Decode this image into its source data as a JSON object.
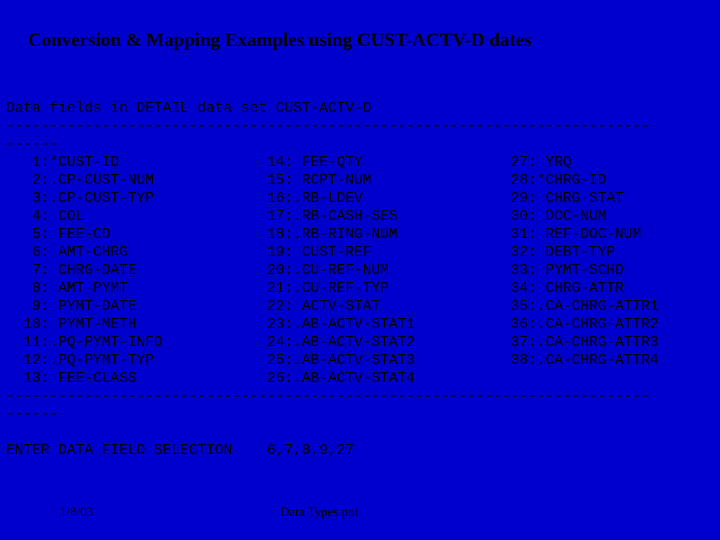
{
  "title": "Conversion & Mapping Examples using CUST-ACTV-D dates",
  "chart_data": {
    "type": "table",
    "header": "Data fields in DETAIL data set CUST-ACTV-D",
    "columns": [
      {
        "items": [
          {
            "n": "1",
            "name": "*CUST-ID"
          },
          {
            "n": "2",
            "name": ".CP-CUST-NUM"
          },
          {
            "n": "3",
            "name": ".CP-CUST-TYP"
          },
          {
            "n": "4",
            "name": "COL"
          },
          {
            "n": "5",
            "name": "FEE-CD"
          },
          {
            "n": "6",
            "name": "AMT-CHRG"
          },
          {
            "n": "7",
            "name": "CHRG-DATE"
          },
          {
            "n": "8",
            "name": "AMT-PYMT"
          },
          {
            "n": "9",
            "name": "PYMT-DATE"
          },
          {
            "n": "10",
            "name": "PYMT-METH"
          },
          {
            "n": "11",
            "name": ".PQ-PYMT-INFO"
          },
          {
            "n": "12",
            "name": ".PQ-PYMT-TYP"
          },
          {
            "n": "13",
            "name": "FEE-CLASS"
          }
        ]
      },
      {
        "items": [
          {
            "n": "14",
            "name": "FEE-QTY"
          },
          {
            "n": "15",
            "name": "RCPT-NUM"
          },
          {
            "n": "16",
            "name": ".RB-LDEV"
          },
          {
            "n": "17",
            "name": ".RB-CASH-SES"
          },
          {
            "n": "18",
            "name": ".RB-RING-NUM"
          },
          {
            "n": "19",
            "name": "CUST-REF"
          },
          {
            "n": "20",
            "name": ".CU-REF-NUM"
          },
          {
            "n": "21",
            "name": ".CU-REF-TYP"
          },
          {
            "n": "22",
            "name": "ACTV-STAT"
          },
          {
            "n": "23",
            "name": ".AB-ACTV-STAT1"
          },
          {
            "n": "24",
            "name": ".AB-ACTV-STAT2"
          },
          {
            "n": "25",
            "name": ".AB-ACTV-STAT3"
          },
          {
            "n": "26",
            "name": ".AB-ACTV-STAT4"
          }
        ]
      },
      {
        "items": [
          {
            "n": "27",
            "name": "YRQ"
          },
          {
            "n": "28",
            "name": "*CHRG-ID"
          },
          {
            "n": "29",
            "name": "CHRG-STAT"
          },
          {
            "n": "30",
            "name": "DOC-NUM"
          },
          {
            "n": "31",
            "name": "REF-DOC-NUM"
          },
          {
            "n": "32",
            "name": "DEBT-TYP"
          },
          {
            "n": "33",
            "name": "PYMT-SCHD"
          },
          {
            "n": "34",
            "name": "CHRG-ATTR"
          },
          {
            "n": "35",
            "name": ".CA-CHRG-ATTR1"
          },
          {
            "n": "36",
            "name": ".CA-CHRG-ATTR2"
          },
          {
            "n": "37",
            "name": ".CA-CHRG-ATTR3"
          },
          {
            "n": "38",
            "name": ".CA-CHRG-ATTR4"
          }
        ]
      }
    ],
    "prompt": "ENTER DATA FIELD SELECTION",
    "selection": "6,7,8,9,27"
  },
  "footer": {
    "date": "1/8/03",
    "filename": "Data Types.ppt"
  }
}
